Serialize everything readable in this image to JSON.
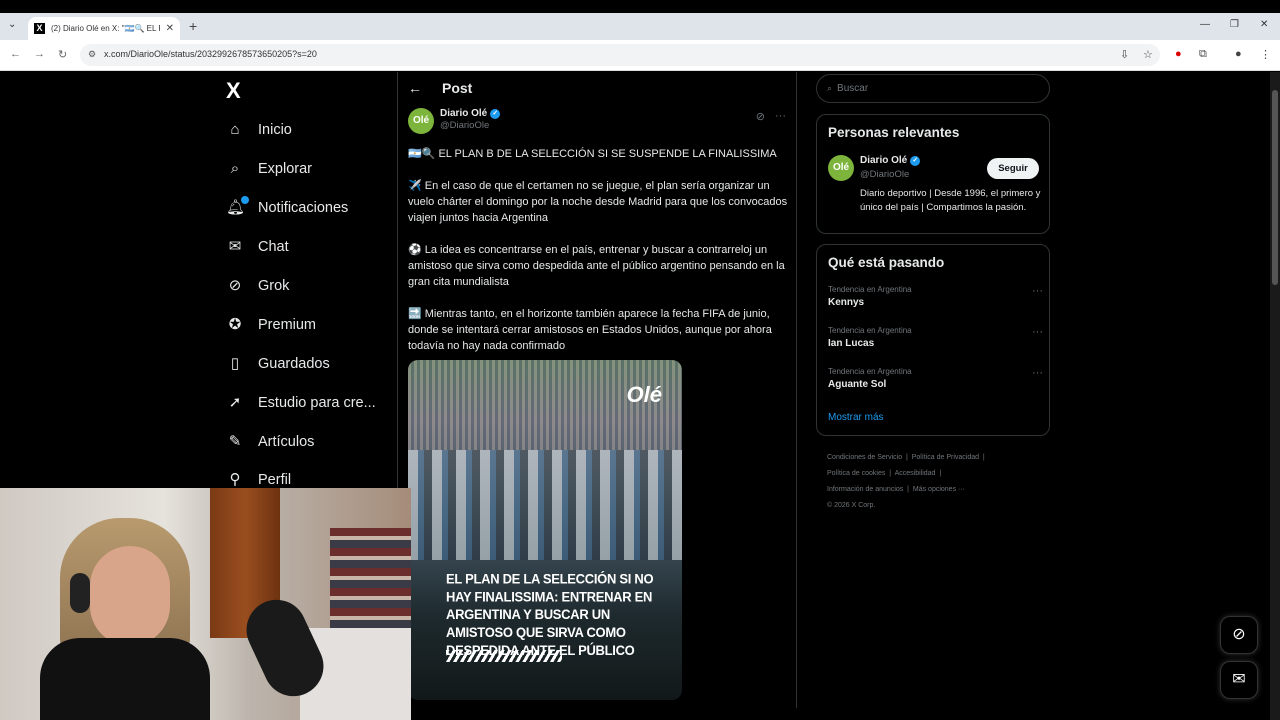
{
  "browser": {
    "tab_title": "(2) Diario Olé en X: \"🇦🇷🔍 EL PL",
    "tab_favicon": "X",
    "url": "x.com/DiarioOle/status/2032992678573650205?s=20"
  },
  "nav": {
    "logo": "X",
    "items": [
      {
        "label": "Inicio",
        "icon": "home-icon"
      },
      {
        "label": "Explorar",
        "icon": "search-icon"
      },
      {
        "label": "Notificaciones",
        "icon": "bell-icon"
      },
      {
        "label": "Chat",
        "icon": "mail-icon"
      },
      {
        "label": "Grok",
        "icon": "grok-icon"
      },
      {
        "label": "Premium",
        "icon": "premium-icon"
      },
      {
        "label": "Guardados",
        "icon": "bookmark-icon"
      },
      {
        "label": "Estudio para cre...",
        "icon": "rocket-icon"
      },
      {
        "label": "Artículos",
        "icon": "article-icon"
      },
      {
        "label": "Perfil",
        "icon": "profile-icon"
      }
    ]
  },
  "post": {
    "header_title": "Post",
    "author_name": "Diario Olé",
    "author_handle": "@DiarioOle",
    "avatar_text": "Olé",
    "paragraphs": [
      "🇦🇷🔍 EL PLAN B DE LA SELECCIÓN SI SE SUSPENDE LA FINALISSIMA",
      "✈️ En el caso de que el certamen no se juegue, el plan sería organizar un vuelo chárter el domingo por la noche desde Madrid para que los convocados viajen juntos hacia Argentina",
      "⚽ La idea es concentrarse en el país, entrenar y buscar a contrarreloj un amistoso que sirva como despedida ante el público argentino pensando en la gran cita mundialista",
      "🔜 Mientras tanto, en el horizonte también aparece la fecha FIFA de junio, donde se intentará cerrar amistosos en Estados Unidos, aunque por ahora todavía no hay nada confirmado"
    ],
    "image_logo": "Olé",
    "image_caption": "EL PLAN DE LA SELECCIÓN SI NO HAY FINALISSIMA: ENTRENAR EN ARGENTINA Y BUSCAR UN AMISTOSO QUE SIRVA COMO DESPEDIDA ANTE EL PÚBLICO"
  },
  "sidebar": {
    "search_placeholder": "Buscar",
    "relevant_title": "Personas relevantes",
    "relevant": {
      "name": "Diario Olé",
      "handle": "@DiarioOle",
      "follow_label": "Seguir",
      "bio": "Diario deportivo | Desde 1996, el primero y único del país | Compartimos la pasión."
    },
    "trending_title": "Qué está pasando",
    "trends": [
      {
        "meta": "Tendencia en Argentina",
        "name": "Kennys"
      },
      {
        "meta": "Tendencia en Argentina",
        "name": "Ian Lucas"
      },
      {
        "meta": "Tendencia en Argentina",
        "name": "Aguante Sol"
      }
    ],
    "show_more": "Mostrar más",
    "footer": {
      "terms": "Condiciones de Servicio",
      "privacy": "Política de Privacidad",
      "cookies": "Política de cookies",
      "accessibility": "Accesibilidad",
      "ads": "Información de anuncios",
      "more": "Más opciones ···",
      "copyright": "© 2026 X Corp."
    }
  },
  "colors": {
    "accent": "#1d9bf0",
    "background": "#000000",
    "ole_green": "#7db53c"
  }
}
